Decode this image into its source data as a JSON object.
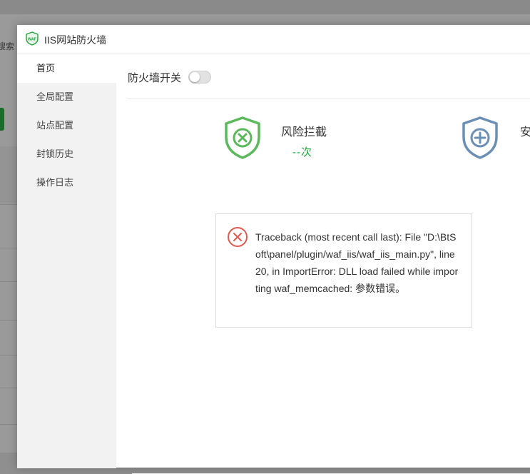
{
  "background": {
    "search_text": "搜索"
  },
  "window": {
    "title": "IIS网站防火墙",
    "logo": "waf-shield-logo"
  },
  "sidebar": {
    "items": [
      {
        "label": "首页"
      },
      {
        "label": "全局配置"
      },
      {
        "label": "站点配置"
      },
      {
        "label": "封锁历史"
      },
      {
        "label": "操作日志"
      }
    ],
    "active_index": 0
  },
  "main": {
    "firewall_switch_label": "防火墙开关",
    "firewall_enabled": false,
    "stats": [
      {
        "label": "风险拦截",
        "value": "--次",
        "icon": "shield-x-icon",
        "color": "#5cb85c"
      },
      {
        "label": "安",
        "icon": "shield-plus-icon",
        "color": "#6b8fb5"
      }
    ]
  },
  "error": {
    "icon": "error-circle-x-icon",
    "message": "Traceback (most recent call last): File \"D:\\BtSoft\\panel/plugin/waf_iis/waf_iis_main.py\", line 20, in ImportError: DLL load failed while importing waf_memcached: 参数错误。"
  },
  "colors": {
    "accent": "#20a53a",
    "error": "#e05a4f"
  }
}
